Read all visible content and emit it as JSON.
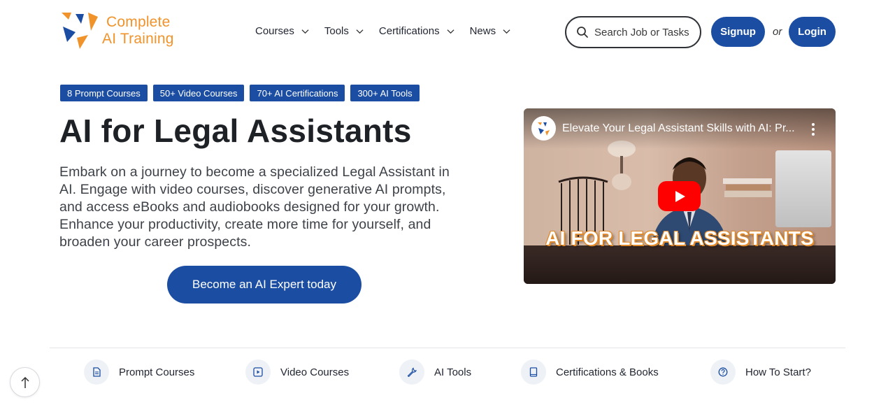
{
  "header": {
    "logo": {
      "line1": "Complete",
      "line2": "AI Training",
      "color": "#f0932b"
    },
    "nav": [
      {
        "label": "Courses",
        "icon": "chevron-down-icon"
      },
      {
        "label": "Tools",
        "icon": "chevron-down-icon"
      },
      {
        "label": "Certifications",
        "icon": "chevron-down-icon"
      },
      {
        "label": "News",
        "icon": "chevron-down-icon"
      }
    ],
    "search": {
      "placeholder": "Search Job or Tasks",
      "icon": "search-icon"
    },
    "signup_label": "Signup",
    "or_label": "or",
    "login_label": "Login",
    "accent": "#1b4ea3"
  },
  "hero": {
    "badges": [
      "8 Prompt Courses",
      "50+ Video Courses",
      "70+ AI Certifications",
      "300+ AI Tools"
    ],
    "title": "AI for Legal Assistants",
    "description": "Embark on a journey to become a specialized Legal Assistant in AI. Engage with video courses, discover generative AI prompts, and access eBooks and audiobooks designed for your growth. Enhance your productivity, create more time for yourself, and broaden your career prospects.",
    "cta_label": "Become an AI Expert today"
  },
  "video": {
    "title": "Elevate Your Legal Assistant Skills with AI: Pr...",
    "caption": "AI FOR LEGAL ASSISTANTS",
    "play_icon": "play-icon",
    "menu_icon": "more-vertical-icon"
  },
  "quick_links": [
    {
      "label": "Prompt Courses",
      "icon": "document-icon"
    },
    {
      "label": "Video Courses",
      "icon": "video-icon"
    },
    {
      "label": "AI Tools",
      "icon": "wrench-icon"
    },
    {
      "label": "Certifications & Books",
      "icon": "book-icon"
    },
    {
      "label": "How To Start?",
      "icon": "question-icon"
    }
  ],
  "scroll_top_icon": "arrow-up-icon"
}
